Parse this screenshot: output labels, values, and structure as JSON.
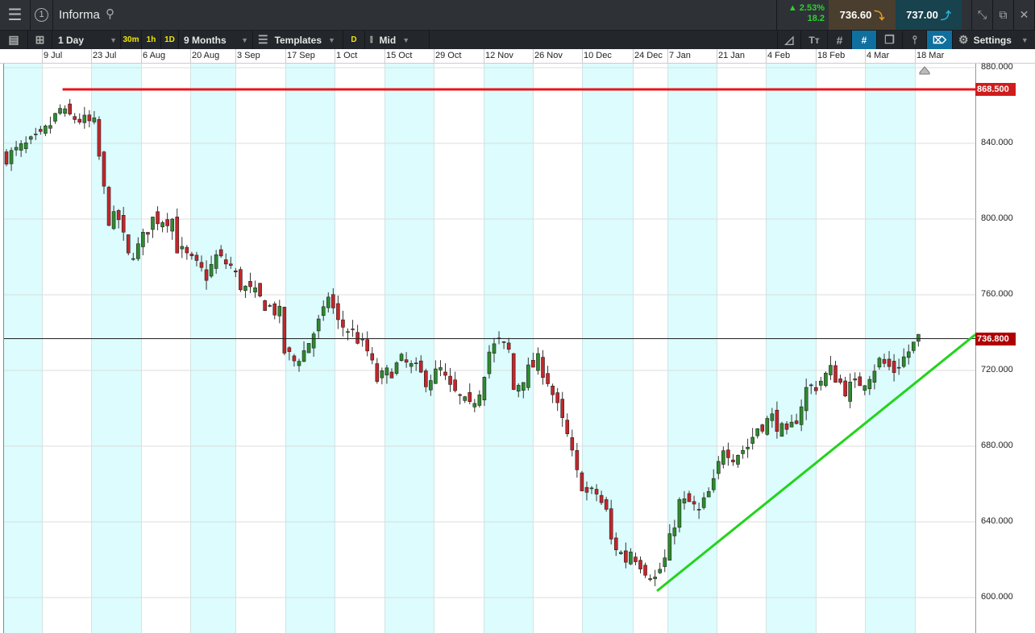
{
  "header": {
    "instrument": "Informa",
    "counter": "1",
    "change_pct": "2.53%",
    "change_abs": "18.2",
    "sell_price": "736.60",
    "buy_price": "737.00"
  },
  "toolbar": {
    "interval": "1 Day",
    "q30m": "30m",
    "q1h": "1h",
    "q1d": "1D",
    "range": "9 Months",
    "templates": "Templates",
    "d": "D",
    "price_type": "Mid",
    "settings": "Settings"
  },
  "colors": {
    "up": "#2e8b2e",
    "down": "#c4262b",
    "sell_bg": "#4a3e2e",
    "buy_bg": "#18424d",
    "resistance": "#e8141a",
    "trend": "#22d41c"
  },
  "chart_data": {
    "type": "candlestick",
    "x_labels": [
      "9 Jul",
      "23 Jul",
      "6 Aug",
      "20 Aug",
      "3 Sep",
      "17 Sep",
      "1 Oct",
      "15 Oct",
      "29 Oct",
      "12 Nov",
      "26 Nov",
      "10 Dec",
      "24 Dec",
      "7 Jan",
      "21 Jan",
      "4 Feb",
      "18 Feb",
      "4 Mar",
      "18 Mar"
    ],
    "y_ticks": [
      "880.000",
      "840.000",
      "800.000",
      "760.000",
      "720.000",
      "680.000",
      "640.000",
      "600.000"
    ],
    "ylim": [
      592,
      889
    ],
    "close_path": [
      [
        0,
        833
      ],
      [
        7,
        843
      ],
      [
        9,
        850
      ],
      [
        11,
        858
      ],
      [
        12,
        855
      ],
      [
        18,
        850
      ],
      [
        20,
        815
      ],
      [
        21,
        800
      ],
      [
        23,
        800
      ],
      [
        25,
        780
      ],
      [
        27,
        785
      ],
      [
        28,
        790
      ],
      [
        30,
        800
      ],
      [
        34,
        800
      ],
      [
        35,
        785
      ],
      [
        37,
        780
      ],
      [
        39,
        775
      ],
      [
        41,
        770
      ],
      [
        43,
        780
      ],
      [
        46,
        775
      ],
      [
        48,
        765
      ],
      [
        51,
        760
      ],
      [
        53,
        755
      ],
      [
        56,
        750
      ],
      [
        57,
        730
      ],
      [
        59,
        725
      ],
      [
        61,
        730
      ],
      [
        63,
        740
      ],
      [
        65,
        750
      ],
      [
        66,
        760
      ],
      [
        68,
        745
      ],
      [
        71,
        740
      ],
      [
        74,
        730
      ],
      [
        76,
        715
      ],
      [
        79,
        720
      ],
      [
        81,
        725
      ],
      [
        84,
        720
      ],
      [
        86,
        715
      ],
      [
        89,
        720
      ],
      [
        91,
        710
      ],
      [
        95,
        700
      ],
      [
        97,
        710
      ],
      [
        99,
        730
      ],
      [
        101,
        735
      ],
      [
        103,
        730
      ],
      [
        104,
        710
      ],
      [
        107,
        720
      ],
      [
        109,
        725
      ],
      [
        111,
        715
      ],
      [
        113,
        700
      ],
      [
        115,
        685
      ],
      [
        117,
        665
      ],
      [
        119,
        655
      ],
      [
        121,
        655
      ],
      [
        123,
        645
      ],
      [
        124,
        630
      ],
      [
        127,
        620
      ],
      [
        128,
        625
      ],
      [
        131,
        615
      ],
      [
        133,
        610
      ],
      [
        135,
        620
      ],
      [
        137,
        640
      ],
      [
        138,
        650
      ],
      [
        140,
        650
      ],
      [
        142,
        645
      ],
      [
        145,
        660
      ],
      [
        147,
        680
      ],
      [
        149,
        675
      ],
      [
        152,
        680
      ],
      [
        154,
        690
      ],
      [
        157,
        695
      ],
      [
        160,
        685
      ],
      [
        162,
        695
      ],
      [
        164,
        710
      ],
      [
        166,
        712
      ],
      [
        169,
        720
      ],
      [
        172,
        710
      ],
      [
        176,
        715
      ],
      [
        179,
        725
      ],
      [
        182,
        720
      ],
      [
        185,
        730
      ],
      [
        187,
        737
      ]
    ],
    "resistance": {
      "value": 868.5,
      "label": "868.500",
      "from_index": 11.5
    },
    "current": {
      "value": 736.8,
      "label": "736.800"
    },
    "trendline": [
      [
        133.4,
        603.5
      ],
      [
        198.7,
        739
      ]
    ]
  }
}
